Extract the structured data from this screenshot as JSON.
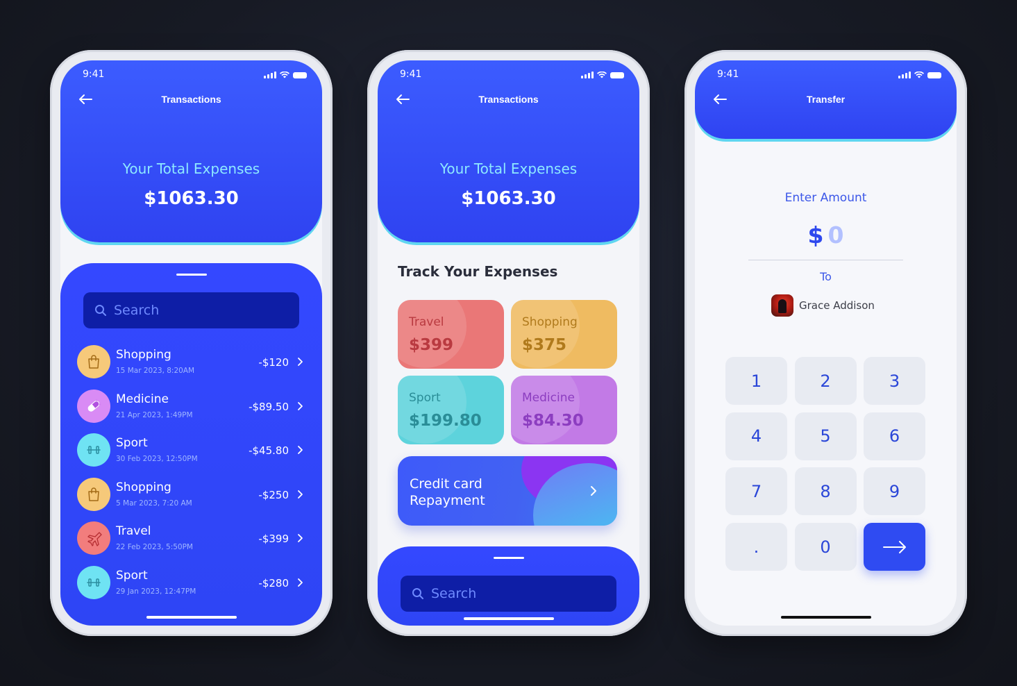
{
  "status_time": "9:41",
  "phone1": {
    "title": "Transactions",
    "expenses_label": "Your Total Expenses",
    "expenses_value": "$1063.30",
    "search_placeholder": "Search",
    "transactions": [
      {
        "name": "Shopping",
        "date": "15 Mar 2023, 8:20AM",
        "amount": "-$120",
        "icon": "shopping-bag-icon",
        "color": "#f6c97a"
      },
      {
        "name": "Medicine",
        "date": "21 Apr 2023, 1:49PM",
        "amount": "-$89.50",
        "icon": "pill-icon",
        "color": "#d98bf5"
      },
      {
        "name": "Sport",
        "date": "30 Feb 2023, 12:50PM",
        "amount": "-$45.80",
        "icon": "dumbbell-icon",
        "color": "#6fe3f3"
      },
      {
        "name": "Shopping",
        "date": "5 Mar 2023, 7:20 AM",
        "amount": "-$250",
        "icon": "shopping-bag-icon",
        "color": "#f6c97a"
      },
      {
        "name": "Travel",
        "date": "22 Feb 2023, 5:50PM",
        "amount": "-$399",
        "icon": "airplane-icon",
        "color": "#f27d7d"
      },
      {
        "name": "Sport",
        "date": "29 Jan 2023, 12:47PM",
        "amount": "-$280",
        "icon": "dumbbell-icon",
        "color": "#6fe3f3"
      }
    ]
  },
  "phone2": {
    "title": "Transactions",
    "expenses_label": "Your Total Expenses",
    "expenses_value": "$1063.30",
    "track_title": "Track Your Expenses",
    "cards": [
      {
        "label": "Travel",
        "value": "$399",
        "bg": "#ea7777",
        "text": "#b93a40"
      },
      {
        "label": "Shopping",
        "value": "$375",
        "bg": "#efbb61",
        "text": "#b07a1c"
      },
      {
        "label": "Sport",
        "value": "$199.80",
        "bg": "#5dd3dc",
        "text": "#2a8d97"
      },
      {
        "label": "Medicine",
        "value": "$84.30",
        "bg": "#c27ae6",
        "text": "#8c3dc0"
      }
    ],
    "credit_card_line1": "Credit card",
    "credit_card_line2": "Repayment",
    "search_placeholder": "Search"
  },
  "phone3": {
    "title": "Transfer",
    "enter_amount": "Enter Amount",
    "currency": "$",
    "amount": "0",
    "to_label": "To",
    "recipient": "Grace Addison",
    "keys": [
      "1",
      "2",
      "3",
      "4",
      "5",
      "6",
      "7",
      "8",
      "9",
      ".",
      "0"
    ]
  }
}
